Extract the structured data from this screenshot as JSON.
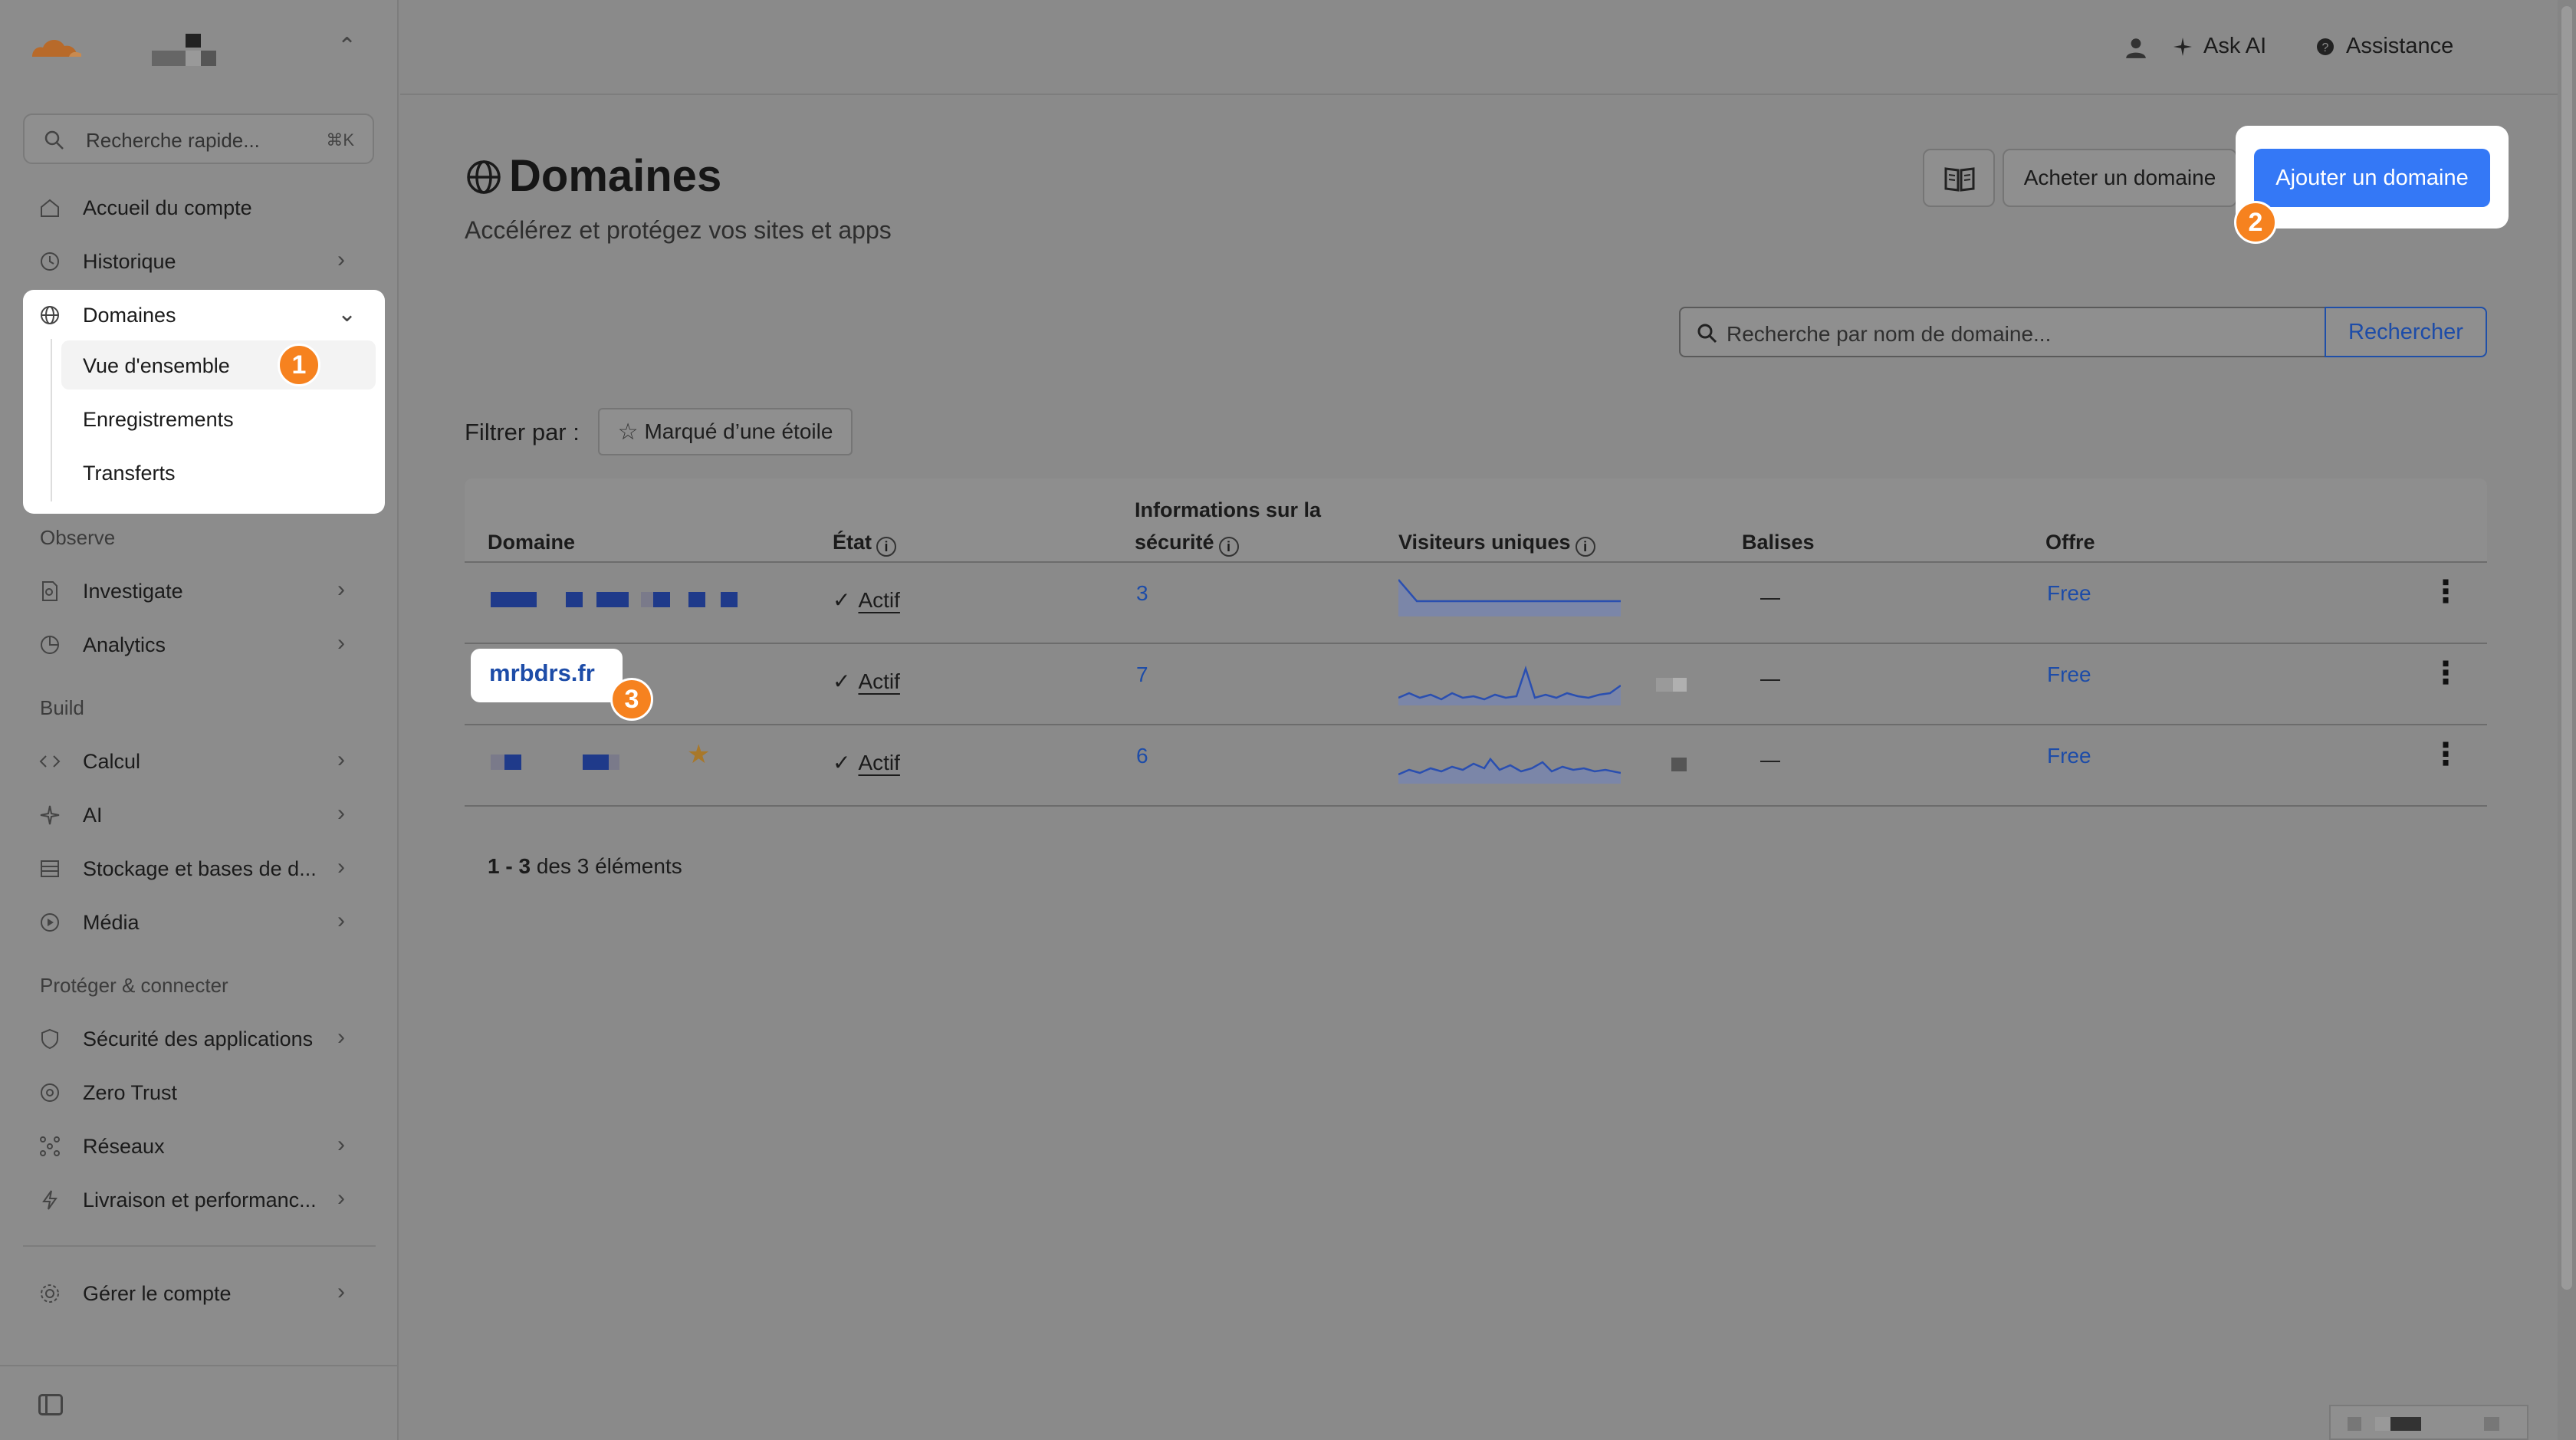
{
  "sidebar": {
    "search_placeholder": "Recherche rapide...",
    "search_shortcut": "⌘K",
    "items": {
      "home": "Accueil du compte",
      "history": "Historique",
      "domains": "Domaines",
      "overview": "Vue d'ensemble",
      "registrations": "Enregistrements",
      "transfers": "Transferts",
      "investigate": "Investigate",
      "analytics": "Analytics",
      "compute": "Calcul",
      "ai": "AI",
      "storage": "Stockage et bases de d...",
      "media": "Média",
      "app_security": "Sécurité des applications",
      "zero_trust": "Zero Trust",
      "networks": "Réseaux",
      "delivery": "Livraison et performanc...",
      "manage": "Gérer le compte"
    },
    "sections": {
      "observe": "Observe",
      "build": "Build",
      "protect": "Protéger & connecter"
    }
  },
  "topbar": {
    "ask_ai": "Ask AI",
    "support": "Assistance"
  },
  "page": {
    "title": "Domaines",
    "subtitle": "Accélérez et protégez vos sites et apps",
    "buy_button": "Acheter un domaine",
    "add_button": "Ajouter un domaine",
    "search_placeholder": "Recherche par nom de domaine...",
    "search_button": "Rechercher",
    "filter_label": "Filtrer par :",
    "filter_chip": "Marqué d’une étoile"
  },
  "table": {
    "headers": {
      "domain": "Domaine",
      "state": "État",
      "security_line1": "Informations sur la",
      "security_line2": "sécurité",
      "visitors": "Visiteurs uniques",
      "tags": "Balises",
      "plan": "Offre"
    },
    "rows": [
      {
        "domain": "",
        "state": "Actif",
        "security": "3",
        "tags": "—",
        "plan": "Free"
      },
      {
        "domain": "mrbdrs.fr",
        "state": "Actif",
        "security": "7",
        "tags": "—",
        "plan": "Free"
      },
      {
        "domain": "",
        "state": "Actif",
        "security": "6",
        "tags": "—",
        "plan": "Free"
      }
    ],
    "pager_range": "1 - 3",
    "pager_text": "des 3 éléments"
  },
  "annotations": {
    "badge1": "1",
    "badge2": "2",
    "badge3": "3"
  },
  "colors": {
    "accent": "#3478f6",
    "link": "#1d4ca8",
    "badge": "#f6821f",
    "logo": "#f6821f"
  }
}
